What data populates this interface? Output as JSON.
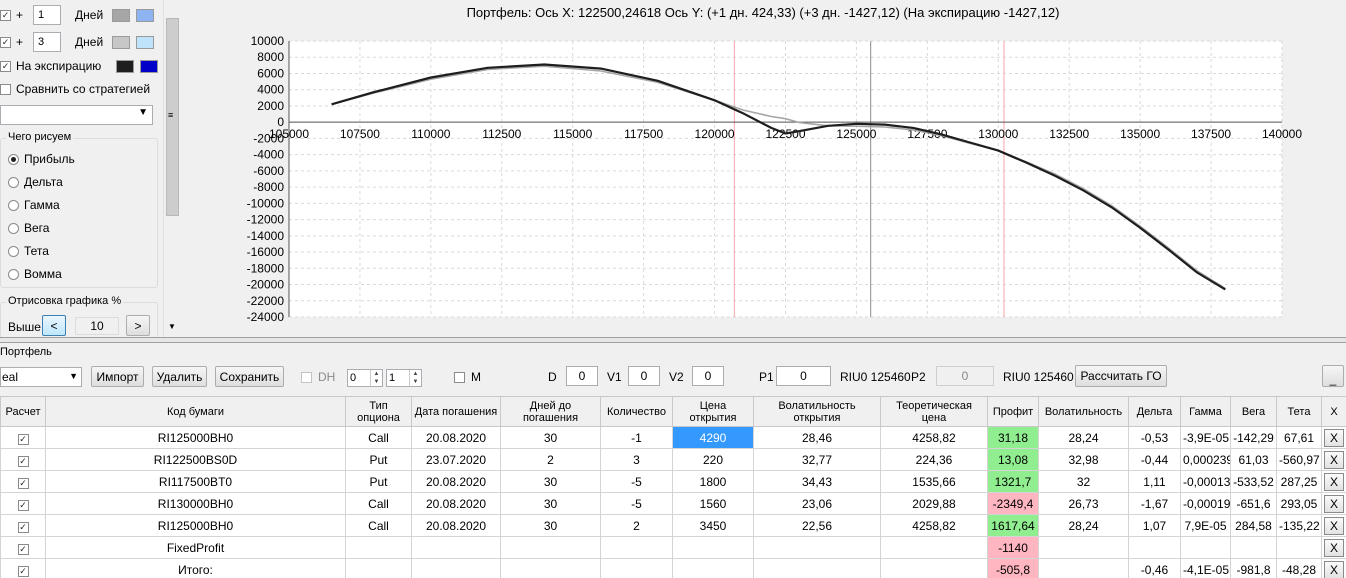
{
  "left_panel": {
    "rows": [
      {
        "checked": true,
        "plus": "+",
        "value": "1",
        "label": "Дней",
        "color1": "#a6a6a6",
        "color2": "#8db4f0"
      },
      {
        "checked": true,
        "plus": "+",
        "value": "3",
        "label": "Дней",
        "color1": "#c7c7c7",
        "color2": "#bfe3fb"
      },
      {
        "checked": true,
        "label": "На экспирацию",
        "color1": "#1e1e1e",
        "color2": "#0000c8"
      }
    ],
    "compare_label": "Сравнить со стратегией",
    "what_to_draw": {
      "title": "Чего рисуем",
      "options": [
        "Прибыль",
        "Дельта",
        "Гамма",
        "Вега",
        "Тета",
        "Вомма"
      ],
      "selected": 0
    },
    "render": {
      "title": "Отрисовка графика %",
      "above_label": "Выше",
      "prev": "<",
      "value": "10",
      "next": ">"
    }
  },
  "chart": {
    "header": "Портфель: Ось X:  122500,24618 Ось Y:   (+1 дн. 424,33)  (+3 дн.  -1427,12)  (На экспирацию -1427,12)",
    "chart_data": {
      "type": "line",
      "xlim": [
        105000,
        140000
      ],
      "ylim": [
        -24000,
        10000
      ],
      "x_ticks": [
        "105000",
        "107500",
        "110000",
        "112500",
        "115000",
        "117500",
        "120000",
        "122500",
        "125000",
        "127500",
        "130000",
        "132500",
        "135000",
        "137500",
        "140000"
      ],
      "y_ticks": [
        "10000",
        "8000",
        "6000",
        "4000",
        "2000",
        "0",
        "-2000",
        "-4000",
        "-6000",
        "-8000",
        "-10000",
        "-12000",
        "-14000",
        "-16000",
        "-18000",
        "-20000",
        "-22000",
        "-24000"
      ],
      "grid": true,
      "vertical_lines": [
        {
          "x": 120700,
          "color": "#f4b6b6"
        },
        {
          "x": 125500,
          "color": "#a0a0a0"
        },
        {
          "x": 130200,
          "color": "#f4b6b6"
        }
      ],
      "series": [
        {
          "color": "#1e1e1e",
          "x": [
            106500,
            108000,
            110000,
            112000,
            114000,
            116000,
            118000,
            120000,
            121000,
            122000,
            122500,
            123000,
            124000,
            125000,
            126000,
            127000,
            128000,
            129000,
            130000,
            131000,
            132000,
            133000,
            134000,
            135000,
            136000,
            137000,
            138000
          ],
          "y": [
            2200,
            3700,
            5500,
            6700,
            7100,
            6600,
            5100,
            2700,
            1100,
            -700,
            -1400,
            -1100,
            -450,
            -200,
            -300,
            -700,
            -1500,
            -2500,
            -3500,
            -5000,
            -6600,
            -8400,
            -10500,
            -13000,
            -15700,
            -18500,
            -20600
          ]
        },
        {
          "color": "#a6a6a6",
          "x": [
            106500,
            108000,
            110000,
            112000,
            114000,
            116000,
            118000,
            120000,
            121000,
            122000,
            122500,
            123000,
            124000,
            125000,
            126000,
            127000,
            128000,
            129000,
            130000,
            131000,
            132000,
            133000,
            134000,
            135000,
            136000,
            137000,
            138000
          ],
          "y": [
            2200,
            3600,
            5300,
            6500,
            6900,
            6300,
            4900,
            2700,
            1500,
            700,
            424,
            -50,
            -450,
            -500,
            -600,
            -950,
            -1650,
            -2600,
            -3500,
            -4900,
            -6400,
            -8200,
            -10300,
            -12800,
            -15500,
            -18300,
            -20500
          ]
        }
      ]
    }
  },
  "portfolio": {
    "label": "Портфель",
    "toolbar": {
      "mode_value": "eal",
      "import": "Импорт",
      "delete": "Удалить",
      "save": "Сохранить",
      "dh": "DH",
      "spin1": "0",
      "spin2": "1",
      "m": "M",
      "d_label": "D",
      "d_value": "0",
      "v1_label": "V1",
      "v1_value": "0",
      "v2_label": "V2",
      "v2_value": "0",
      "p1_label": "P1",
      "p1_value": "0",
      "p1_ticker": "RIU0 125460",
      "p2_label": "P2",
      "p2_value": "0",
      "p2_ticker": "RIU0 125460",
      "calc_go": "Рассчитать ГО",
      "minimize": "_"
    },
    "columns": [
      "Расчет",
      "Код бумаги",
      "Тип опциона",
      "Дата погашения",
      "Дней до погашения",
      "Количество",
      "Цена открытия",
      "Волатильность открытия",
      "Теоретическая цена",
      "Профит",
      "Волатильность",
      "Дельта",
      "Гамма",
      "Вега",
      "Тета",
      "X"
    ],
    "rows": [
      {
        "code": "RI125000BH0",
        "type": "Call",
        "date": "20.08.2020",
        "days": "30",
        "qty": "-1",
        "price": "4290",
        "vol_open": "28,46",
        "theo": "4258,82",
        "profit": "31,18",
        "profit_color": "#90ee90",
        "vol": "28,24",
        "delta": "-0,53",
        "gamma": "-3,9E-05",
        "vega": "-142,29",
        "theta": "67,61",
        "x": "X",
        "price_selected": true
      },
      {
        "code": "RI122500BS0D",
        "type": "Put",
        "date": "23.07.2020",
        "days": "2",
        "qty": "3",
        "price": "220",
        "vol_open": "32,77",
        "theo": "224,36",
        "profit": "13,08",
        "profit_color": "#90ee90",
        "vol": "32,98",
        "delta": "-0,44",
        "gamma": "0,000239",
        "vega": "61,03",
        "theta": "-560,97",
        "x": "X"
      },
      {
        "code": "RI117500BT0",
        "type": "Put",
        "date": "20.08.2020",
        "days": "30",
        "qty": "-5",
        "price": "1800",
        "vol_open": "34,43",
        "theo": "1535,66",
        "profit": "1321,7",
        "profit_color": "#90ee90",
        "vol": "32",
        "delta": "1,11",
        "gamma": "-0,00013",
        "vega": "-533,52",
        "theta": "287,25",
        "x": "X"
      },
      {
        "code": "RI130000BH0",
        "type": "Call",
        "date": "20.08.2020",
        "days": "30",
        "qty": "-5",
        "price": "1560",
        "vol_open": "23,06",
        "theo": "2029,88",
        "profit": "-2349,4",
        "profit_color": "#ffb6c1",
        "vol": "26,73",
        "delta": "-1,67",
        "gamma": "-0,00019",
        "vega": "-651,6",
        "theta": "293,05",
        "x": "X"
      },
      {
        "code": "RI125000BH0",
        "type": "Call",
        "date": "20.08.2020",
        "days": "30",
        "qty": "2",
        "price": "3450",
        "vol_open": "22,56",
        "theo": "4258,82",
        "profit": "1617,64",
        "profit_color": "#90ee90",
        "vol": "28,24",
        "delta": "1,07",
        "gamma": "7,9E-05",
        "vega": "284,58",
        "theta": "-135,22",
        "x": "X"
      },
      {
        "code": "FixedProfit",
        "type": "",
        "date": "",
        "days": "",
        "qty": "",
        "price": "",
        "vol_open": "",
        "theo": "",
        "profit": "-1140",
        "profit_color": "#ffb6c1",
        "vol": "",
        "delta": "",
        "gamma": "",
        "vega": "",
        "theta": "",
        "x": "X"
      },
      {
        "code": "Итого:",
        "type": "",
        "date": "",
        "days": "",
        "qty": "",
        "price": "",
        "vol_open": "",
        "theo": "",
        "profit": "-505,8",
        "profit_color": "#ffb6c1",
        "vol": "",
        "delta": "-0,46",
        "gamma": "-4,1E-05",
        "vega": "-981,8",
        "theta": "-48,28",
        "x": "X"
      }
    ]
  }
}
